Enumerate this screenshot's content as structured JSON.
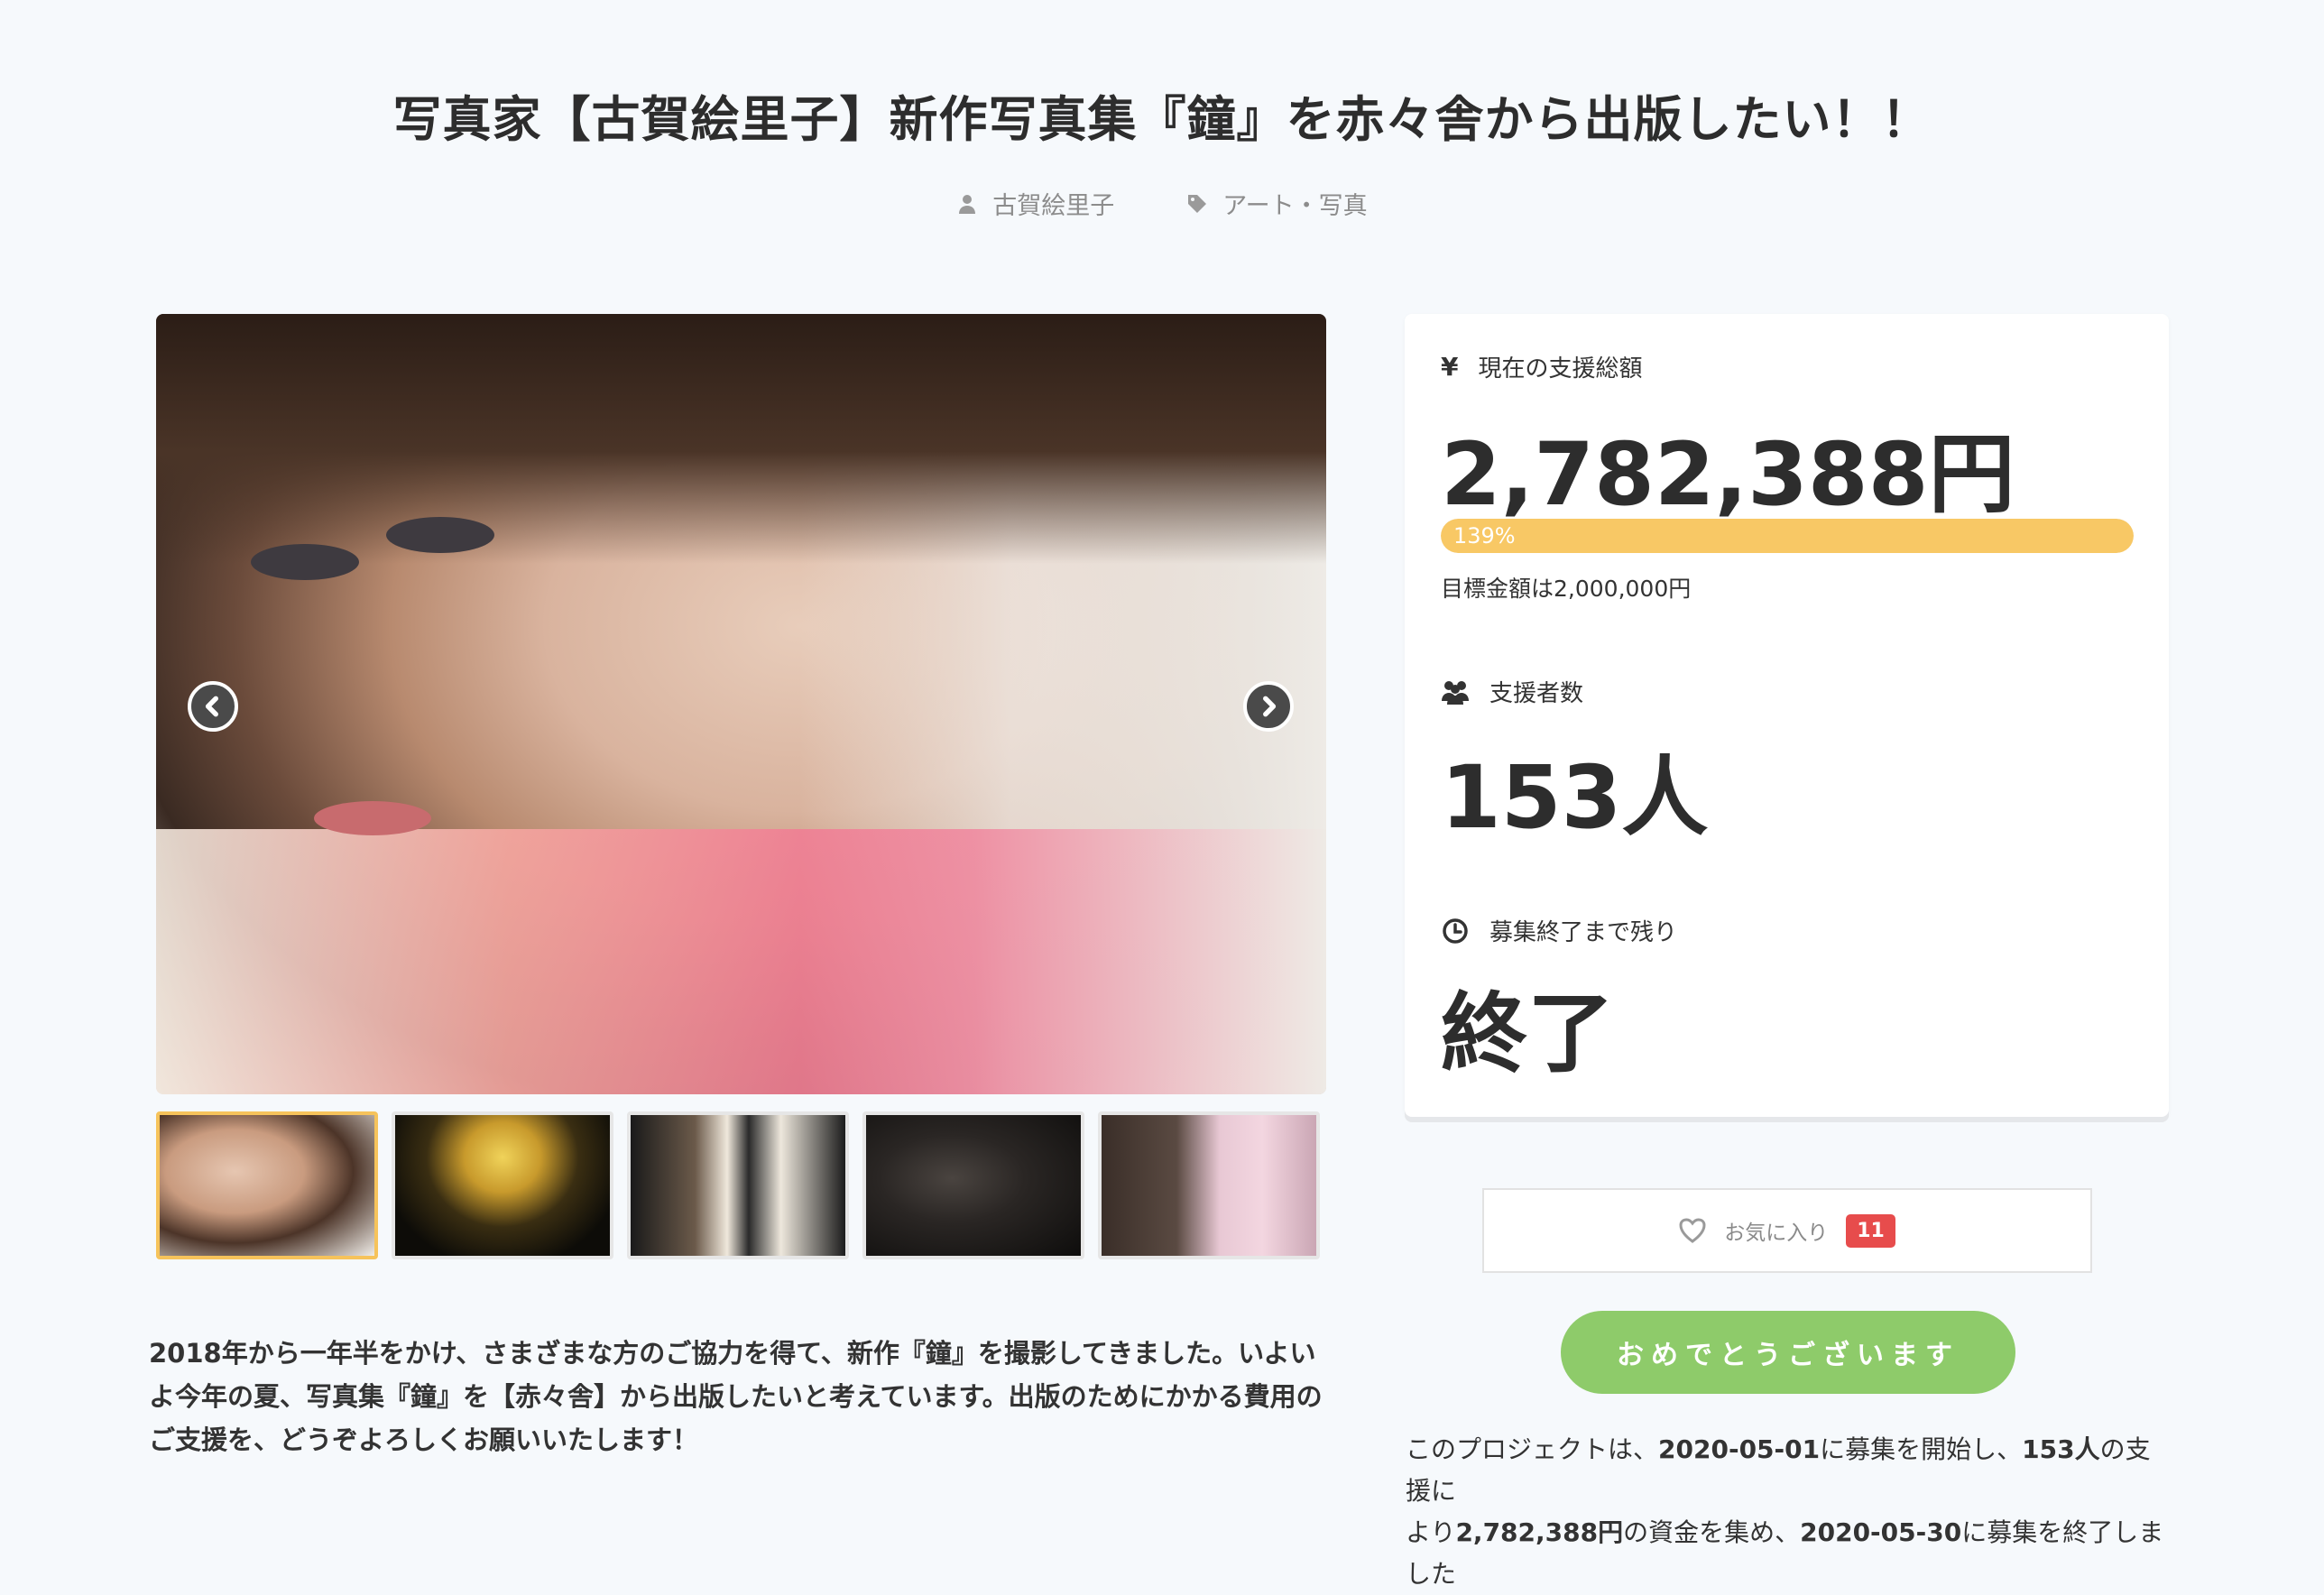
{
  "header": {
    "title": "写真家【古賀絵里子】新作写真集『鐘』を赤々舎から出版したい！！",
    "author": "古賀絵里子",
    "category": "アート・写真"
  },
  "stats": {
    "amount_label": "現在の支援総額",
    "amount_icon": "¥",
    "amount_value": "2,782,388円",
    "progress_percent_label": "139%",
    "progress_fraction": 1.39,
    "goal_text": "目標金額は2,000,000円",
    "backers_label": "支援者数",
    "backers_value": "153人",
    "remaining_label": "募集終了まで残り",
    "remaining_value": "終了"
  },
  "actions": {
    "favorite_label": "お気に入り",
    "favorite_count": "11",
    "congrats_label": "おめでとうございます"
  },
  "description": "2018年から一年半をかけ、さまざまな方のご協力を得て、新作『鐘』を撮影してきました。いよいよ今年の夏、写真集『鐘』を【赤々舎】から出版したいと考えています。出版のためにかかる費用のご支援を、どうぞよろしくお願いいたします！",
  "summary": {
    "p1": "このプロジェクトは、",
    "start_date": "2020-05-01",
    "p2": "に募集を開始し、",
    "backers": "153人",
    "p3": "の支援に",
    "p4": "より",
    "amount": "2,782,388円",
    "p5": "の資金を集め、",
    "end_date": "2020-05-30",
    "p6": "に募集を終了しました"
  },
  "gallery": {
    "thumbnail_count": 5,
    "active_index": 0
  },
  "colors": {
    "accent_yellow": "#f8c865",
    "active_thumb_border": "#f6c35b",
    "congrats_green": "#8ecb6a",
    "badge_red": "#e74c4c",
    "background": "#f6f9fc"
  }
}
